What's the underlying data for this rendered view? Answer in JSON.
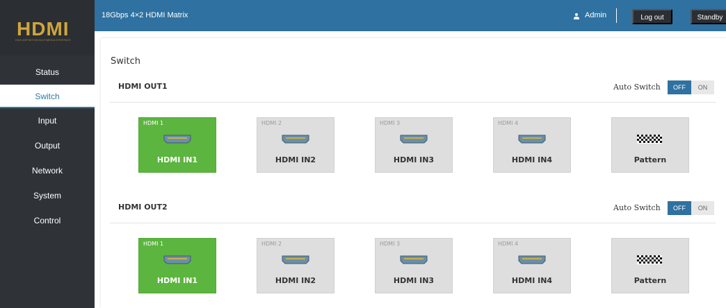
{
  "sidebar": {
    "logo": "HDMI",
    "logo_sub": "HIGH-DEFINITION MULTIMEDIA INTERFACE",
    "items": [
      {
        "label": "Status"
      },
      {
        "label": "Switch"
      },
      {
        "label": "Input"
      },
      {
        "label": "Output"
      },
      {
        "label": "Network"
      },
      {
        "label": "System"
      },
      {
        "label": "Control"
      }
    ],
    "active_index": 1
  },
  "header": {
    "device_title": "18Gbps 4×2 HDMI Matrix",
    "user_label": "Admin",
    "logout_label": "Log out",
    "standby_label": "Standby"
  },
  "main": {
    "page_title": "Switch",
    "outputs": [
      {
        "label": "HDMI OUT1",
        "auto_switch_label": "Auto Switch",
        "toggle_off": "OFF",
        "toggle_on": "ON",
        "auto_switch_state": "OFF",
        "sources": [
          {
            "tag": "HDMI 1",
            "name": "HDMI IN1",
            "selected": true,
            "icon": "hdmi-port-icon"
          },
          {
            "tag": "HDMI 2",
            "name": "HDMI IN2",
            "selected": false,
            "icon": "hdmi-port-icon"
          },
          {
            "tag": "HDMI 3",
            "name": "HDMI IN3",
            "selected": false,
            "icon": "hdmi-port-icon"
          },
          {
            "tag": "HDMI 4",
            "name": "HDMI IN4",
            "selected": false,
            "icon": "hdmi-port-icon"
          },
          {
            "tag": "",
            "name": "Pattern",
            "selected": false,
            "icon": "checkerboard-pattern-icon"
          }
        ]
      },
      {
        "label": "HDMI OUT2",
        "auto_switch_label": "Auto Switch",
        "toggle_off": "OFF",
        "toggle_on": "ON",
        "auto_switch_state": "OFF",
        "sources": [
          {
            "tag": "HDMI 1",
            "name": "HDMI IN1",
            "selected": true,
            "icon": "hdmi-port-icon"
          },
          {
            "tag": "HDMI 2",
            "name": "HDMI IN2",
            "selected": false,
            "icon": "hdmi-port-icon"
          },
          {
            "tag": "HDMI 3",
            "name": "HDMI IN3",
            "selected": false,
            "icon": "hdmi-port-icon"
          },
          {
            "tag": "HDMI 4",
            "name": "HDMI IN4",
            "selected": false,
            "icon": "hdmi-port-icon"
          },
          {
            "tag": "",
            "name": "Pattern",
            "selected": false,
            "icon": "checkerboard-pattern-icon"
          }
        ]
      }
    ]
  },
  "colors": {
    "topbar": "#2f71a0",
    "sidebar": "#2f3338",
    "selected_tile": "#5cb53e",
    "logo_gold": "#cfa53c"
  }
}
